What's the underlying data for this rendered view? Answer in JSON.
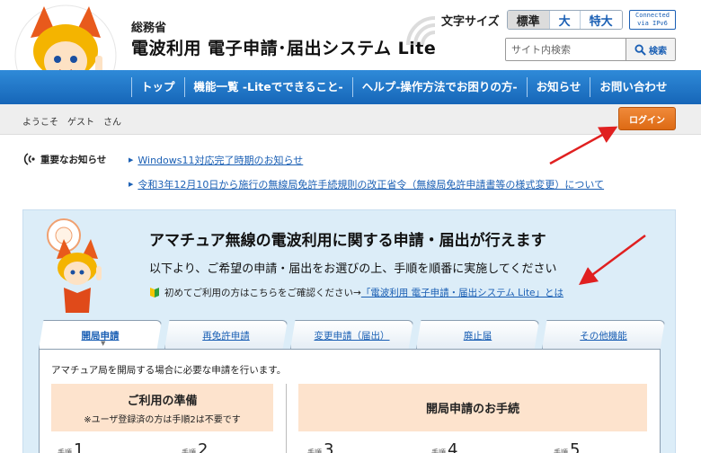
{
  "header": {
    "ministry": "総務省",
    "site_title": "電波利用 電子申請･届出システム Lite",
    "font_size_label": "文字サイズ",
    "font_sizes": [
      "標準",
      "大",
      "特大"
    ],
    "ipv6_badge_line1": "Connected",
    "ipv6_badge_line2": "via IPv6",
    "search_placeholder": "サイト内検索",
    "search_button": "検索"
  },
  "nav": {
    "items": [
      "トップ",
      "機能一覧 -Liteでできること-",
      "ヘルプ-操作方法でお困りの方-",
      "お知らせ",
      "お問い合わせ"
    ]
  },
  "user": {
    "welcome": "ようこそ　ゲスト　さん",
    "login_button": "ログイン"
  },
  "notices": {
    "label": "重要なお知らせ",
    "items": [
      "Windows11対応完了時期のお知らせ",
      "令和3年12月10日から施行の無線局免許手続規則の改正省令（無線局免許申請書等の様式変更）について"
    ]
  },
  "main": {
    "title": "アマチュア無線の電波利用に関する申請・届出が行えます",
    "subtitle": "以下より、ご希望の申請・届出をお選びの上、手順を順番に実施してください",
    "first_time_text": "初めてご利用の方はこちらをご確認ください→",
    "first_time_link": "「電波利用 電子申請・届出システム Lite」とは",
    "tabs": [
      "開局申請",
      "再免許申請",
      "変更申請（届出）",
      "廃止届",
      "その他機能"
    ],
    "content_desc": "アマチュア局を開局する場合に必要な申請を行います。",
    "prep_title": "ご利用の準備",
    "prep_note": "※ユーザ登録済の方は手順2は不要です",
    "proc_title": "開局申請のお手続",
    "step_label": "手順",
    "steps": [
      "1",
      "2",
      "3",
      "4",
      "5"
    ]
  },
  "colors": {
    "nav_blue": "#1a6fc4",
    "login_orange": "#e8772a",
    "panel_bg": "#dcedf8",
    "box_peach": "#fde3cd",
    "link_blue": "#1a5fb4",
    "arrow_red": "#e02020"
  }
}
